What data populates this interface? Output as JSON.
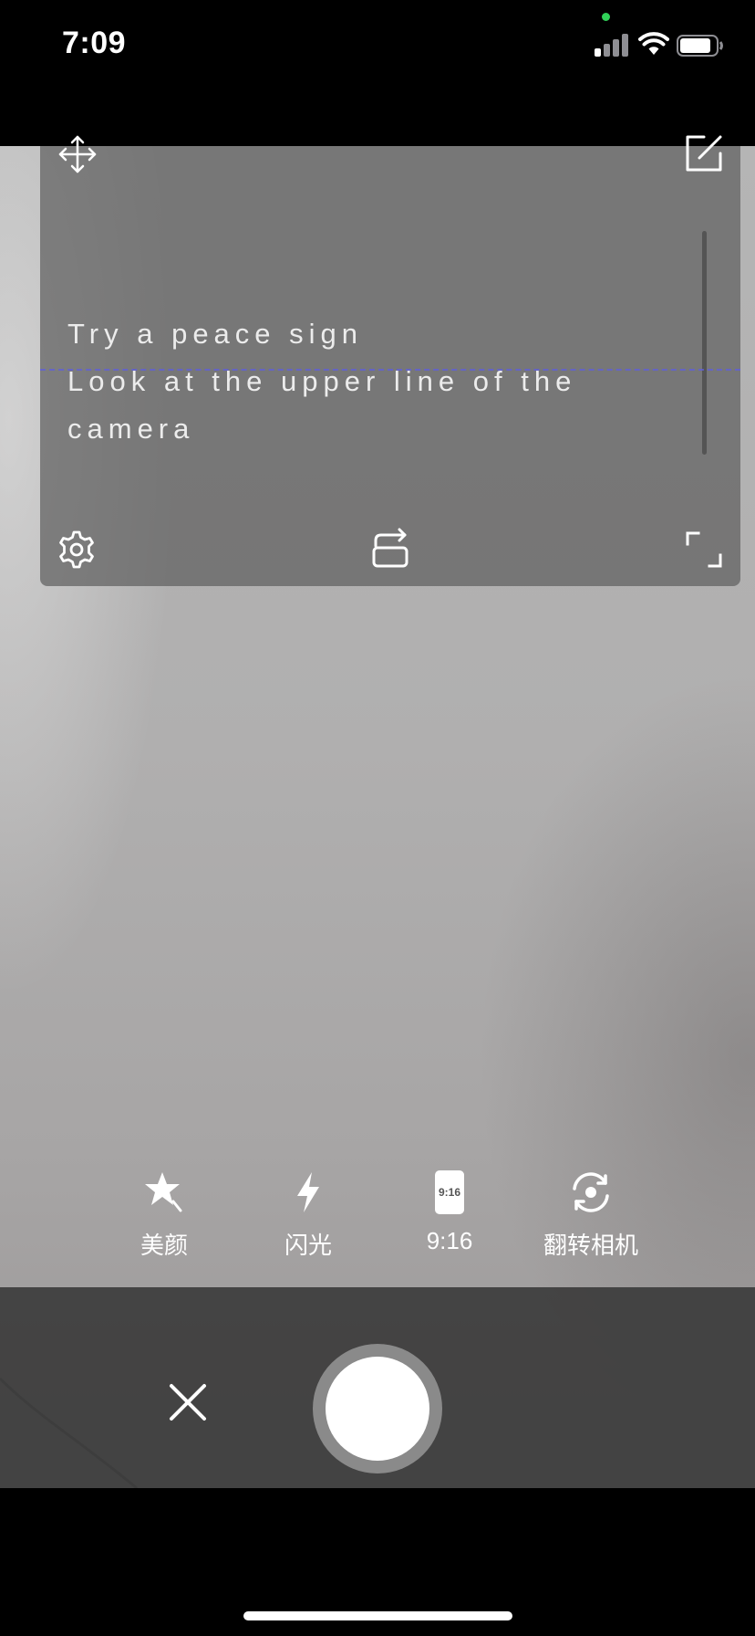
{
  "status_bar": {
    "time": "7:09",
    "icons": [
      "cellular-signal-icon",
      "wifi-icon",
      "battery-icon"
    ]
  },
  "prompter": {
    "lines": [
      "Try a peace sign",
      "Look at the upper line of the",
      "camera"
    ],
    "icons": {
      "top_left": "move-icon",
      "top_right": "edit-icon",
      "bottom_left": "settings-icon",
      "bottom_center": "rotate-icon",
      "bottom_right": "fullscreen-icon"
    },
    "guide_line_color": "#6060d8"
  },
  "tools": [
    {
      "label": "美颜",
      "icon": "beauty-star-icon"
    },
    {
      "label": "闪光",
      "icon": "flash-icon"
    },
    {
      "label": "9:16",
      "icon": "aspect-ratio-icon",
      "icon_text": "9:16"
    },
    {
      "label": "翻转相机",
      "icon": "flip-camera-icon"
    }
  ],
  "controls": {
    "close_icon": "close-icon",
    "shutter": "shutter-button"
  },
  "colors": {
    "status_bar_bg": "#000000",
    "bottom_panel_bg": "#3c3c3c",
    "shutter": "#ffffff",
    "shutter_ring": "#8a8a8a"
  }
}
